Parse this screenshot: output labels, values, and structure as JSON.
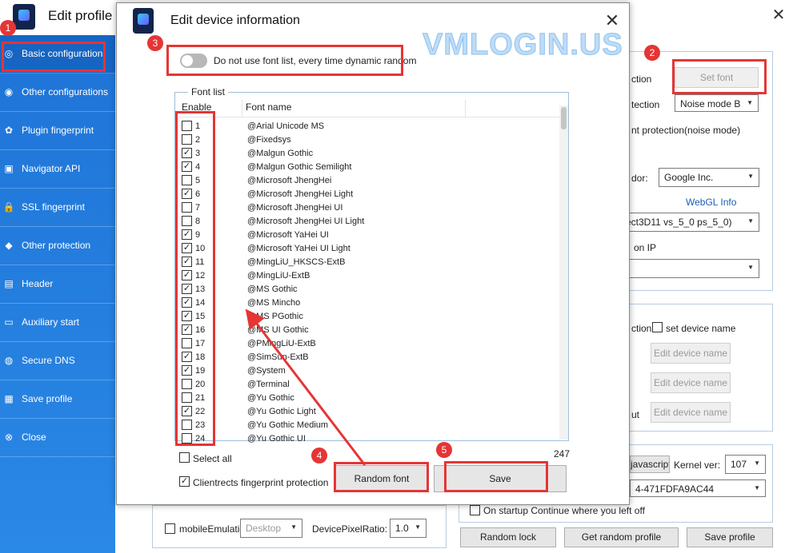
{
  "main": {
    "title": "Edit profile",
    "close_glyph": "✕",
    "sidebar": [
      {
        "label": "Basic configuration",
        "icon": "compass-icon",
        "glyph": "◎"
      },
      {
        "label": "Other configurations",
        "icon": "browser-icon",
        "glyph": "◉"
      },
      {
        "label": "Plugin fingerprint",
        "icon": "puzzle-icon",
        "glyph": "✿"
      },
      {
        "label": "Navigator API",
        "icon": "api-icon",
        "glyph": "▣"
      },
      {
        "label": "SSL fingerprint",
        "icon": "lock-icon",
        "glyph": "🔒"
      },
      {
        "label": "Other protection",
        "icon": "shield-icon",
        "glyph": "◆"
      },
      {
        "label": "Header",
        "icon": "header-icon",
        "glyph": "▤"
      },
      {
        "label": "Auxiliary start",
        "icon": "cmd-icon",
        "glyph": "▭"
      },
      {
        "label": "Secure DNS",
        "icon": "globe-icon",
        "glyph": "◍"
      },
      {
        "label": "Save profile",
        "icon": "floppy-icon",
        "glyph": "▦"
      },
      {
        "label": "Close",
        "icon": "close-circle-icon",
        "glyph": "⊗"
      }
    ],
    "right": {
      "protection_label": "ction",
      "set_font": "Set font",
      "protection2_label": "tection",
      "noise_mode": "Noise mode B",
      "font_protection_label": "nt  protection(noise mode)",
      "vendor_label": "dor:",
      "vendor_value": "Google Inc.",
      "webgl_info": "WebGL Info",
      "renderer_value": "ect3D11 vs_5_0 ps_5_0)",
      "ip_label": "on IP",
      "ip_value": "",
      "device_protection_label": "ction",
      "set_device_name": "set device name",
      "edit_device_name": "Edit device name",
      "ut_label": "ut",
      "javascript_btn": "javascript",
      "kernel_label": "Kernel ver:",
      "kernel_value": "107",
      "uuid_value": "4-471FDFA9AC44",
      "startup_label": "On startup Continue where you left off",
      "random_lock": "Random lock",
      "get_random_profile": "Get random profile",
      "save_profile": "Save profile",
      "mobile_label": "mobileEmulatio",
      "mobile_value": "Desktop",
      "dpr_label": "DevicePixelRatio:",
      "dpr_value": "1.0"
    }
  },
  "dialog": {
    "title": "Edit device information",
    "close_glyph": "✕",
    "toggle_label": "Do not use font list, every time dynamic random",
    "group_label": "Font list",
    "col_enable": "Enable",
    "col_font": "Font name",
    "rows": [
      {
        "n": "1",
        "font": "@Arial Unicode MS",
        "checked": false
      },
      {
        "n": "2",
        "font": "@Fixedsys",
        "checked": false
      },
      {
        "n": "3",
        "font": "@Malgun Gothic",
        "checked": true
      },
      {
        "n": "4",
        "font": "@Malgun Gothic Semilight",
        "checked": true
      },
      {
        "n": "5",
        "font": "@Microsoft JhengHei",
        "checked": false
      },
      {
        "n": "6",
        "font": "@Microsoft JhengHei Light",
        "checked": true
      },
      {
        "n": "7",
        "font": "@Microsoft JhengHei UI",
        "checked": false
      },
      {
        "n": "8",
        "font": "@Microsoft JhengHei UI Light",
        "checked": false
      },
      {
        "n": "9",
        "font": "@Microsoft YaHei UI",
        "checked": true
      },
      {
        "n": "10",
        "font": "@Microsoft YaHei UI Light",
        "checked": true
      },
      {
        "n": "11",
        "font": "@MingLiU_HKSCS-ExtB",
        "checked": true
      },
      {
        "n": "12",
        "font": "@MingLiU-ExtB",
        "checked": true
      },
      {
        "n": "13",
        "font": "@MS Gothic",
        "checked": true
      },
      {
        "n": "14",
        "font": "@MS Mincho",
        "checked": true
      },
      {
        "n": "15",
        "font": "@MS PGothic",
        "checked": true
      },
      {
        "n": "16",
        "font": "@MS UI Gothic",
        "checked": true
      },
      {
        "n": "17",
        "font": "@PMingLiU-ExtB",
        "checked": false
      },
      {
        "n": "18",
        "font": "@SimSun-ExtB",
        "checked": true
      },
      {
        "n": "19",
        "font": "@System",
        "checked": true
      },
      {
        "n": "20",
        "font": "@Terminal",
        "checked": false
      },
      {
        "n": "21",
        "font": "@Yu Gothic",
        "checked": false
      },
      {
        "n": "22",
        "font": "@Yu Gothic Light",
        "checked": true
      },
      {
        "n": "23",
        "font": "@Yu Gothic Medium",
        "checked": false
      },
      {
        "n": "24",
        "font": "@Yu Gothic UI",
        "checked": false
      }
    ],
    "count": "247",
    "select_all": "Select all",
    "clientrects": "Clientrects fingerprint protection",
    "random_font": "Random font",
    "save": "Save"
  },
  "annotations": {
    "badges": [
      "1",
      "2",
      "3",
      "4",
      "5"
    ],
    "accent": "#e53535"
  },
  "watermark": "VMLOGIN.US"
}
